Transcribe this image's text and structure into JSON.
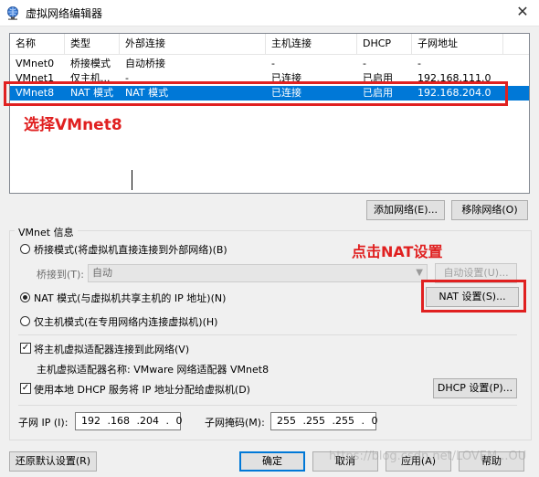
{
  "window": {
    "title": "虚拟网络编辑器",
    "close_glyph": "✕"
  },
  "network_list": {
    "columns": [
      "名称",
      "类型",
      "外部连接",
      "主机连接",
      "DHCP",
      "子网地址"
    ],
    "rows": [
      {
        "name": "VMnet0",
        "type": "桥接模式",
        "external": "自动桥接",
        "host": "-",
        "dhcp": "-",
        "subnet": "-"
      },
      {
        "name": "VMnet1",
        "type": "仅主机...",
        "external": "-",
        "host": "已连接",
        "dhcp": "已启用",
        "subnet": "192.168.111.0"
      },
      {
        "name": "VMnet8",
        "type": "NAT 模式",
        "external": "NAT 模式",
        "host": "已连接",
        "dhcp": "已启用",
        "subnet": "192.168.204.0"
      }
    ],
    "selected_row": "VMnet8"
  },
  "annotations": {
    "select_vmnet8": "选择VMnet8",
    "click_nat_settings": "点击NAT设置"
  },
  "buttons": {
    "add_network": "添加网络(E)...",
    "remove_network": "移除网络(O)",
    "auto_settings": "自动设置(U)...",
    "nat_settings": "NAT 设置(S)...",
    "dhcp_settings": "DHCP 设置(P)...",
    "restore_defaults": "还原默认设置(R)",
    "ok": "确定",
    "cancel": "取消",
    "apply": "应用(A)",
    "help": "帮助"
  },
  "vmnet_info": {
    "group_label": "VMnet 信息",
    "bridged_mode": "桥接模式(将虚拟机直接连接到外部网络)(B)",
    "bridged_to_label": "桥接到(T):",
    "bridged_to_value": "自动",
    "nat_mode": "NAT 模式(与虚拟机共享主机的 IP 地址)(N)",
    "host_only_mode": "仅主机模式(在专用网络内连接虚拟机)(H)",
    "selected_mode": "nat",
    "connect_adapter": "将主机虚拟适配器连接到此网络(V)",
    "adapter_name": "主机虚拟适配器名称: VMware 网络适配器 VMnet8",
    "use_dhcp": "使用本地 DHCP 服务将 IP 地址分配给虚拟机(D)",
    "connect_adapter_checked": true,
    "use_dhcp_checked": true,
    "subnet_ip_label": "子网 IP (I):",
    "subnet_ip_value": "192 .168 .204 . 0",
    "subnet_mask_label": "子网掩码(M):",
    "subnet_mask_value": "255 .255 .255 . 0"
  },
  "watermark": "https://blog.csdn.net/LOVEM...OU",
  "colors": {
    "selection": "#0078d7",
    "annotation": "#e02020",
    "default_button_border": "#0078d7"
  }
}
